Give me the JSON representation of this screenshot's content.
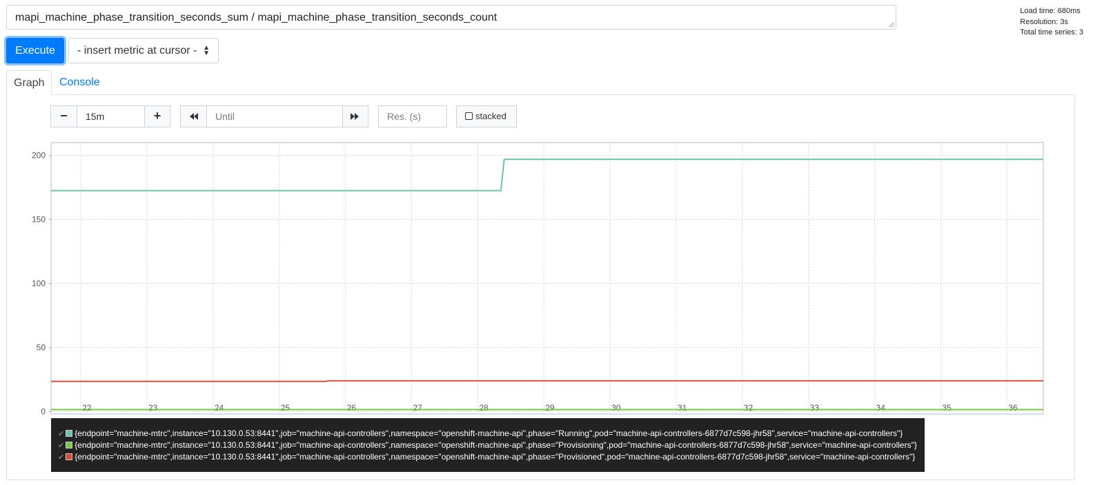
{
  "expression": "mapi_machine_phase_transition_seconds_sum / mapi_machine_phase_transition_seconds_count",
  "stats": {
    "load_time": "Load time: 680ms",
    "resolution": "Resolution: 3s",
    "total_series": "Total time series: 3"
  },
  "toolbar": {
    "execute_label": "Execute",
    "insert_metric_label": "- insert metric at cursor -"
  },
  "tabs": [
    {
      "label": "Graph",
      "active": true
    },
    {
      "label": "Console",
      "active": false
    }
  ],
  "graph_controls": {
    "range_value": "15m",
    "minus_label": "−",
    "plus_label": "+",
    "until_placeholder": "Until",
    "res_placeholder": "Res. (s)",
    "stacked_label": "stacked"
  },
  "chart_data": {
    "type": "line",
    "ylim": [
      -2,
      210
    ],
    "yticks": [
      0,
      50,
      100,
      150,
      200
    ],
    "xlim": [
      21.55,
      36.55
    ],
    "xticks": [
      22,
      23,
      24,
      25,
      26,
      27,
      28,
      29,
      30,
      31,
      32,
      33,
      34,
      35,
      36
    ],
    "grid": true,
    "legend_placement": "bottom",
    "series": [
      {
        "name": "{endpoint=\"machine-mtrc\",instance=\"10.130.0.53:8441\",job=\"machine-api-controllers\",namespace=\"openshift-machine-api\",phase=\"Running\",pod=\"machine-api-controllers-6877d7c598-jhr58\",service=\"machine-api-controllers\"}",
        "color": "#6ac3b1",
        "points": [
          [
            21.55,
            172.5
          ],
          [
            28.35,
            172.5
          ],
          [
            28.4,
            197
          ],
          [
            36.55,
            197
          ]
        ]
      },
      {
        "name": "{endpoint=\"machine-mtrc\",instance=\"10.130.0.53:8441\",job=\"machine-api-controllers\",namespace=\"openshift-machine-api\",phase=\"Provisioning\",pod=\"machine-api-controllers-6877d7c598-jhr58\",service=\"machine-api-controllers\"}",
        "color": "#7ac943",
        "points": [
          [
            21.55,
            1.5
          ],
          [
            36.55,
            1.5
          ]
        ]
      },
      {
        "name": "{endpoint=\"machine-mtrc\",instance=\"10.130.0.53:8441\",job=\"machine-api-controllers\",namespace=\"openshift-machine-api\",phase=\"Provisioned\",pod=\"machine-api-controllers-6877d7c598-jhr58\",service=\"machine-api-controllers\"}",
        "color": "#dc4a38",
        "points": [
          [
            21.55,
            23.5
          ],
          [
            25.7,
            23.5
          ],
          [
            25.75,
            24
          ],
          [
            36.55,
            24
          ]
        ]
      }
    ]
  }
}
